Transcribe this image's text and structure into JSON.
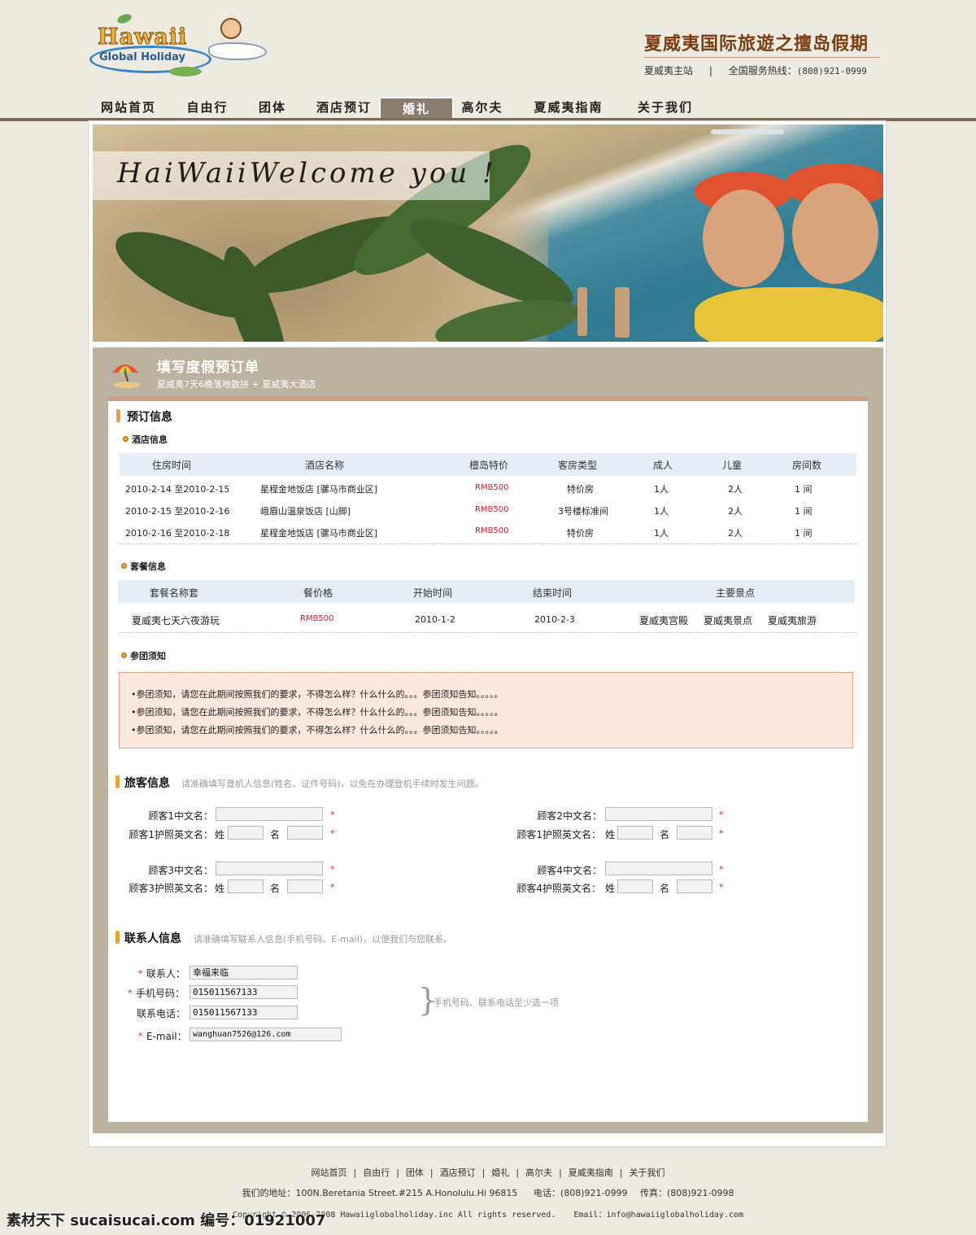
{
  "header": {
    "logo_main": "Hawaii",
    "logo_sub": "Global Holiday",
    "brand": "夏威夷国际旅遊之擅岛假期",
    "main_site": "夏威夷主站",
    "separator": "|",
    "hotline_label": "全国服务热线：",
    "hotline": "(808)921-0999"
  },
  "nav": {
    "items": [
      "网站首页",
      "自由行",
      "团体",
      "酒店预订",
      "婚礼",
      "高尔夫",
      "夏威夷指南",
      "关于我们"
    ],
    "active": "婚礼"
  },
  "banner": {
    "title": "HaiWaiiWelcome you !"
  },
  "form": {
    "title": "填写度假预订单",
    "subtitle": "夏威夷7天6晚落地散拼 + 夏威夷大酒店"
  },
  "booking": {
    "heading": "预订信息",
    "hotel": {
      "heading": "酒店信息",
      "columns": [
        "住房时间",
        "酒店名称",
        "檀岛特价",
        "客房类型",
        "成人",
        "儿童",
        "房间数"
      ],
      "rows": [
        [
          "2010-2-14 至2010-2-15",
          "星程金地饭店 [骡马市商业区]",
          "RMB500",
          "特价房",
          "1人",
          "2人",
          "1 间"
        ],
        [
          "2010-2-15 至2010-2-16",
          "峨眉山温泉饭店 [山脚]",
          "RMB500",
          "3号楼标准间",
          "1人",
          "2人",
          "1 间"
        ],
        [
          "2010-2-16 至2010-2-18",
          "星程金地饭店 [骡马市商业区]",
          "RMB500",
          "特价房",
          "1人",
          "2人",
          "1 间"
        ]
      ]
    },
    "package": {
      "heading": "套餐信息",
      "columns": [
        "套餐名称套",
        "餐价格",
        "开始时间",
        "结束时间",
        "主要景点"
      ],
      "rows": [
        [
          "夏威夷七天六夜游玩",
          "RMB500",
          "2010-1-2",
          "2010-2-3",
          "夏威夷宫殿",
          "夏威夷景点",
          "夏威夷旅游"
        ]
      ]
    },
    "notice": {
      "heading": "参团须知",
      "lines": [
        "•参团须知，请您在此期间按照我们的要求，不得怎么样？什么什么的。。。参团须知告知。。。。。",
        "•参团须知，请您在此期间按照我们的要求，不得怎么样？什么什么的。。。参团须知告知。。。。。",
        "•参团须知，请您在此期间按照我们的要求，不得怎么样？什么什么的。。。参团须知告知。。。。。"
      ]
    }
  },
  "travelers": {
    "heading": "旅客信息",
    "note": "请准确填写登机人信息(姓名、证件号码)，以免在办理登机手续时发生问题。",
    "surname_label": "姓",
    "given_label": "名",
    "required_mark": "*",
    "items": [
      {
        "cn_label": "顾客1中文名：",
        "en_label": "顾客1护照英文名："
      },
      {
        "cn_label": "顾客2中文名：",
        "en_label": "顾客1护照英文名："
      },
      {
        "cn_label": "顾客3中文名：",
        "en_label": "顾客3护照英文名："
      },
      {
        "cn_label": "顾客4中文名：",
        "en_label": "顾客4护照英文名："
      }
    ]
  },
  "contact": {
    "heading": "联系人信息",
    "note": "请准确填写联系人信息(手机号码、E-mail)，以便我们与您联系。",
    "name_label": "联系人：",
    "name_value": "幸福来临",
    "mobile_label": "手机号码：",
    "mobile_value": "015011567133",
    "phone_label": "联系电话：",
    "phone_value": "015011567133",
    "email_label": "E-mail：",
    "email_value": "wanghuan7526@126.com",
    "hint": "手机号码、联系电话至少选一项"
  },
  "footer": {
    "links": [
      "网站首页",
      "自由行",
      "团体",
      "酒店预订",
      "婚礼",
      "高尔夫",
      "夏威夷指南",
      "关于我们"
    ],
    "link_sep": "|",
    "address": "我们的地址：100N.Beretania Street.#215 A.Honolulu.Hi 96815",
    "tel": "电话：(808)921-0999",
    "fax": "传真：(808)921-0998",
    "copyright": "Copyright © 2006-2008 Hawaiiglobalholiday.inc All rights reserved.",
    "email": "Email：info@hawaiiglobalholiday.com"
  },
  "watermark": "素材天下 sucaisucai.com  编号：01921007",
  "colors": {
    "page_bg": "#edeae1",
    "nav_active": "#8a7e6e",
    "panel": "#bbb39f",
    "price_red": "#c0282d",
    "notice_bg": "#fde8dd",
    "accent_orange": "#e8a23a"
  }
}
